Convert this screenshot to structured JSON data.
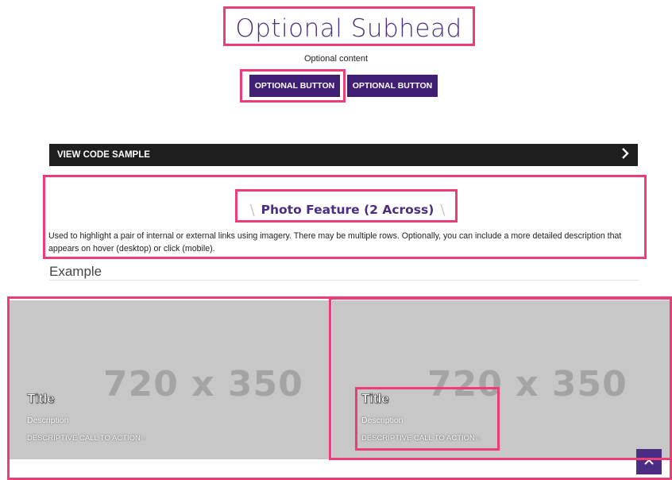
{
  "hero": {
    "subhead": "Optional Subhead",
    "content": "Optional content",
    "button_1": "OPTIONAL BUTTON",
    "button_2": "OPTIONAL BUTTON"
  },
  "code_sample": {
    "label": "VIEW CODE SAMPLE",
    "icon": "chevron-right-icon"
  },
  "section": {
    "title": "Photo Feature (2 Across)",
    "description": "Used to highlight a pair of internal or external links using imagery. There may be multiple rows. Optionally, you can include a more detailed description that appears on hover (desktop) or click (mobile).",
    "example_label": "Example"
  },
  "cards": [
    {
      "placeholder": "720 x 350",
      "title": "Title",
      "description": "Description",
      "cta": "DESCRIPTIVE CALL TO ACTION",
      "cta_arrow": "›"
    },
    {
      "placeholder": "720 x 350",
      "title": "Title",
      "description": "Description",
      "cta": "DESCRIPTIVE CALL TO ACTION",
      "cta_arrow": "›"
    }
  ],
  "back_to_top": {
    "icon": "chevron-up-icon"
  },
  "colors": {
    "brand_purple": "#4b2e83",
    "button_purple": "#3f1f73",
    "highlight": "#ec3d76",
    "code_bar": "#1f1e1e",
    "card_placeholder": "#c7c7c7"
  }
}
